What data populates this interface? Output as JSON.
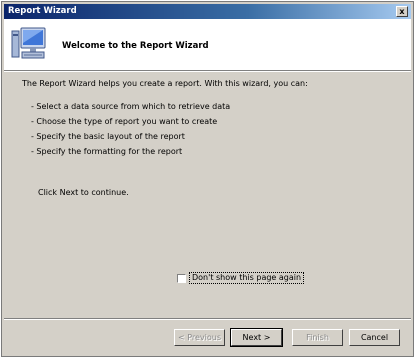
{
  "window": {
    "title": "Report Wizard",
    "close_label": "x"
  },
  "banner": {
    "title": "Welcome to the Report Wizard",
    "icon": "computer-monitor-icon"
  },
  "intro": "The Report Wizard helps you create a report. With this wizard, you can:",
  "bullets": [
    "- Select a data source from which to retrieve data",
    "- Choose the type of report you want to create",
    "- Specify the basic layout of the report",
    "- Specify the formatting for the report"
  ],
  "continue_text": "Click Next to continue.",
  "checkbox": {
    "label": "Don't show this page again",
    "checked": false
  },
  "buttons": {
    "previous": "< Previous",
    "next": "Next >",
    "finish": "Finish",
    "cancel": "Cancel"
  }
}
